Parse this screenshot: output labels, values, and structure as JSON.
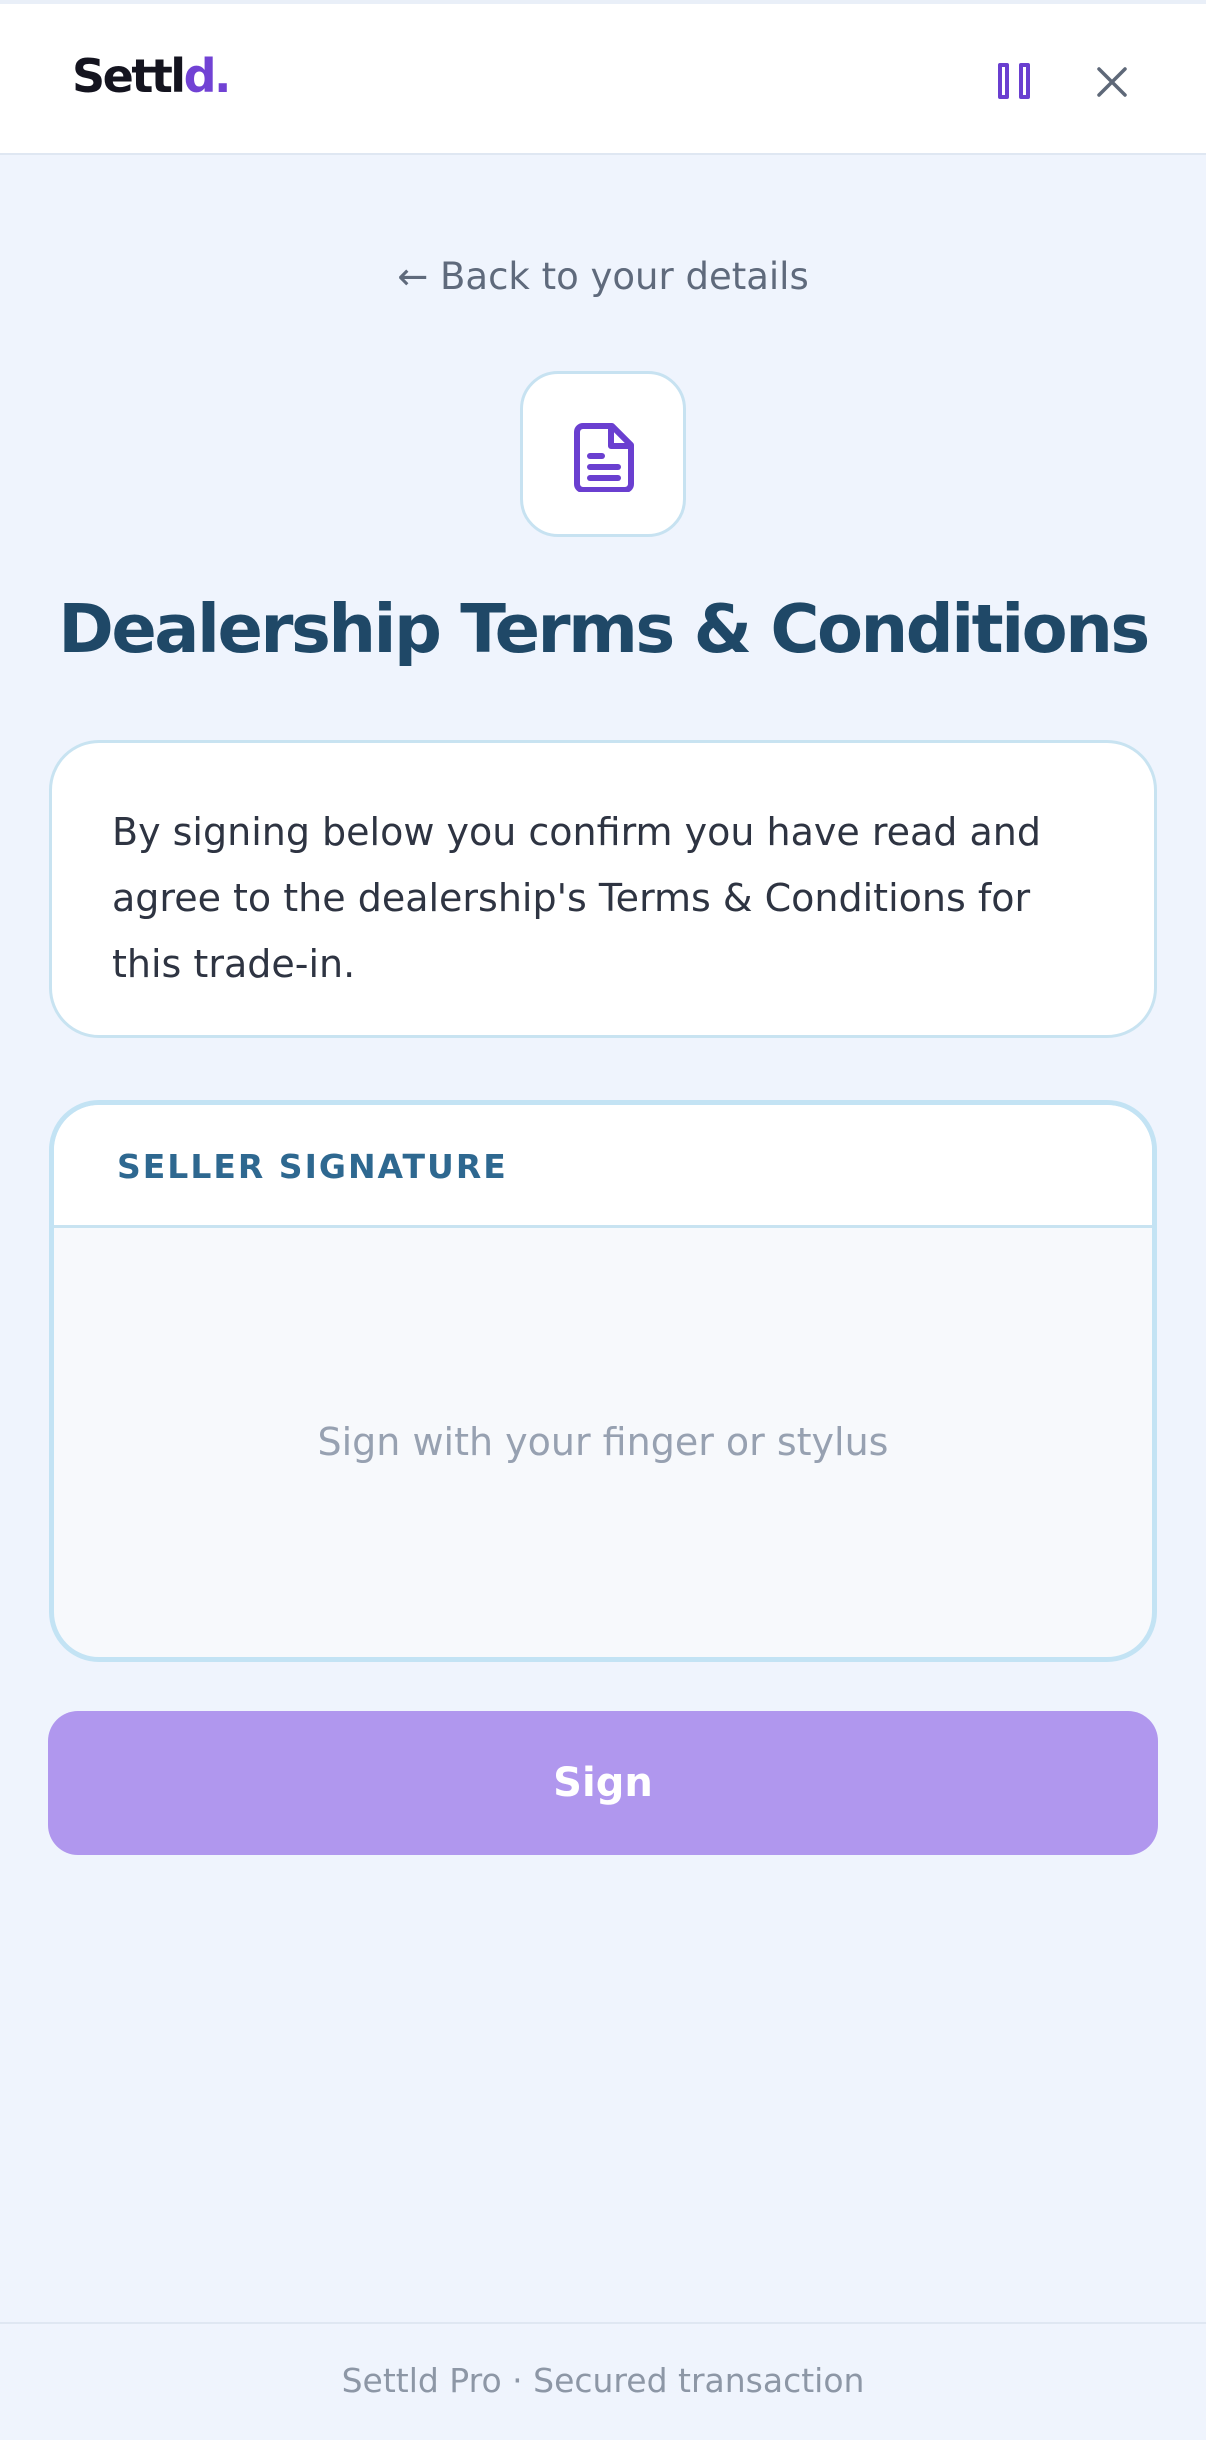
{
  "header": {
    "logo_main": "Settl",
    "logo_accent": "d.",
    "pause_icon": "pause-icon",
    "close_icon": "close-icon"
  },
  "nav": {
    "back_label": "← Back to your details"
  },
  "document_icon": "document-icon",
  "title": "Dealership Terms & Conditions",
  "info_text": "By signing below you confirm you have read and agree to the dealership's Terms & Conditions for this trade-in.",
  "signature": {
    "label": "SELLER SIGNATURE",
    "placeholder": "Sign with your finger or stylus"
  },
  "sign_button": "Sign",
  "footer": "Settld Pro · Secured transaction",
  "colors": {
    "accent": "#7142d4",
    "title": "#1f4867",
    "button_disabled": "#b097ee",
    "background": "#eff4fd",
    "border": "#c8e3f1"
  }
}
